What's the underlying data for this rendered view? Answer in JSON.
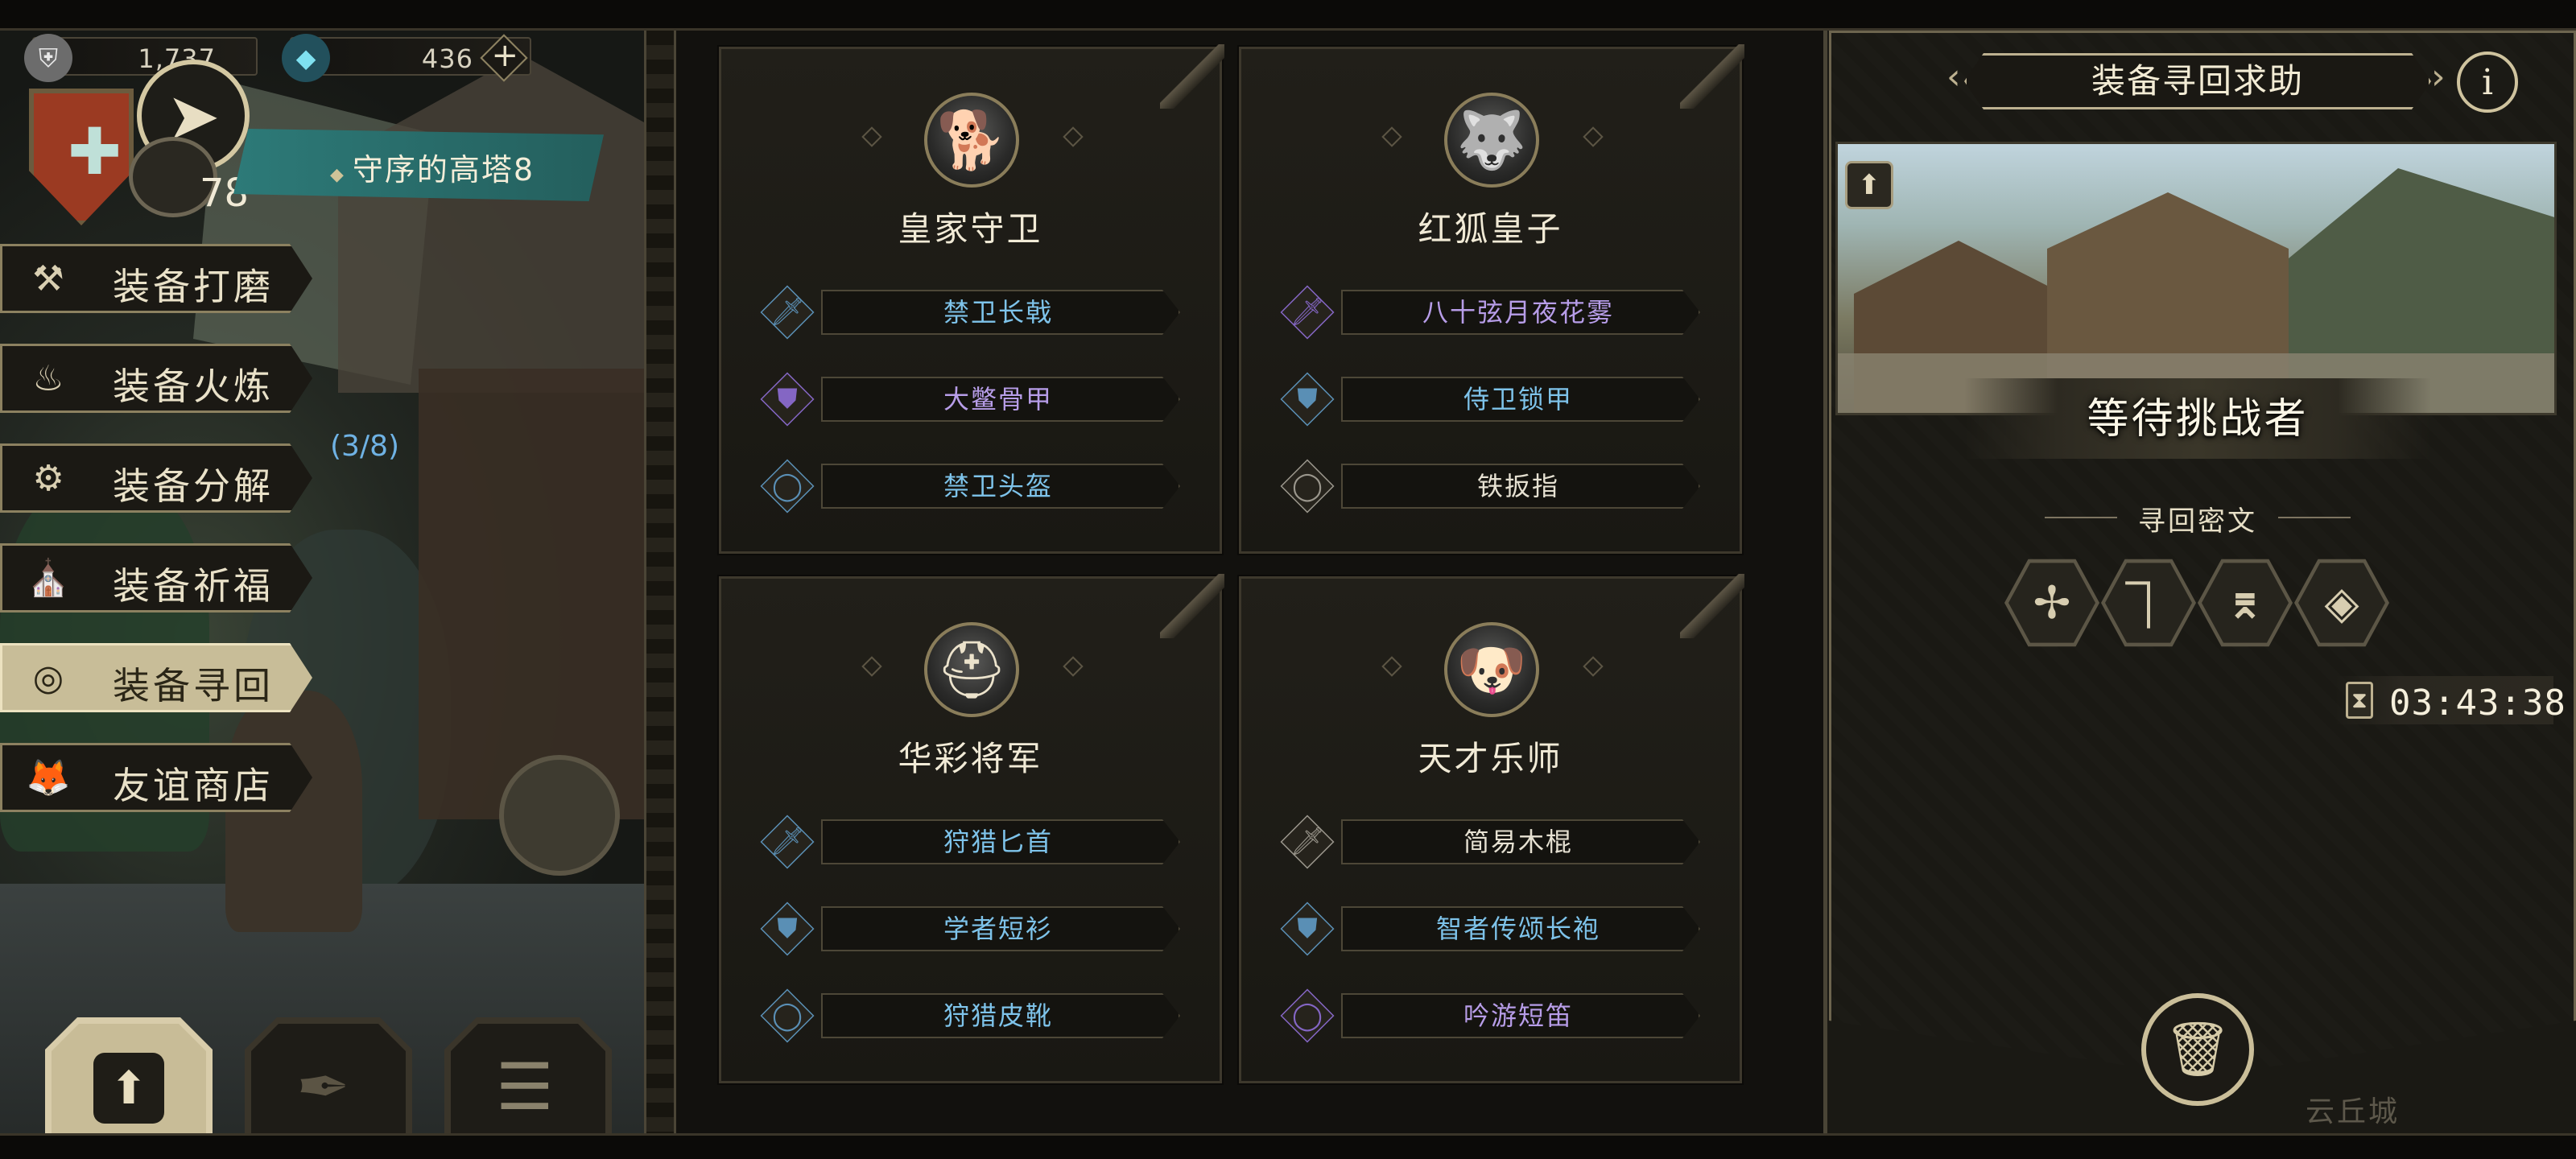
{
  "currencies": [
    {
      "name": "silver",
      "value": "1,737",
      "icon": "shield-coin-icon"
    },
    {
      "name": "gem",
      "value": "436",
      "icon": "crystal-icon"
    }
  ],
  "player": {
    "level": "78",
    "location": "守序的高塔8"
  },
  "left_menu": {
    "items": [
      {
        "key": "polish",
        "label": "装备打磨",
        "icon": "hammer-icon",
        "active": false
      },
      {
        "key": "forge",
        "label": "装备火炼",
        "icon": "flame-icon",
        "active": false
      },
      {
        "key": "dismantle",
        "label": "装备分解",
        "icon": "gear-break-icon",
        "active": false
      },
      {
        "key": "bless",
        "label": "装备祈福",
        "icon": "praying-hands-icon",
        "active": false
      },
      {
        "key": "retrieve",
        "label": "装备寻回",
        "icon": "target-icon",
        "active": true
      },
      {
        "key": "shop",
        "label": "友谊商店",
        "icon": "fox-icon",
        "active": false
      }
    ],
    "progress_text": "(3/8)"
  },
  "cards": [
    {
      "name": "皇家守卫",
      "portrait": "armored-dog-portrait",
      "equipment": [
        {
          "name": "禁卫长戟",
          "icon": "sword-icon",
          "color": "#7ec3ea",
          "slot_color": "#5a8fb5"
        },
        {
          "name": "大鳖骨甲",
          "icon": "armor-icon",
          "color": "#b79de8",
          "slot_color": "#8466c4"
        },
        {
          "name": "禁卫头盔",
          "icon": "ring-icon",
          "color": "#7ec3ea",
          "slot_color": "#5a8fb5"
        }
      ]
    },
    {
      "name": "红狐皇子",
      "portrait": "wolf-prince-portrait",
      "equipment": [
        {
          "name": "八十弦月夜花雾",
          "icon": "sword-icon",
          "color": "#b79de8",
          "slot_color": "#8466c4"
        },
        {
          "name": "侍卫锁甲",
          "icon": "armor-icon",
          "color": "#7ec3ea",
          "slot_color": "#5a8fb5"
        },
        {
          "name": "铁扳指",
          "icon": "ring-icon",
          "color": "#e6e1d2",
          "slot_color": "#9a968c"
        }
      ]
    },
    {
      "name": "华彩将军",
      "portrait": "helmeted-general-portrait",
      "equipment": [
        {
          "name": "狩猎匕首",
          "icon": "sword-icon",
          "color": "#7ec3ea",
          "slot_color": "#5a8fb5"
        },
        {
          "name": "学者短衫",
          "icon": "armor-icon",
          "color": "#7ec3ea",
          "slot_color": "#5a8fb5"
        },
        {
          "name": "狩猎皮靴",
          "icon": "ring-icon",
          "color": "#7ec3ea",
          "slot_color": "#5a8fb5"
        }
      ]
    },
    {
      "name": "天才乐师",
      "portrait": "dog-musician-portrait",
      "equipment": [
        {
          "name": "简易木棍",
          "icon": "sword-icon",
          "color": "#e6e1d2",
          "slot_color": "#9a968c"
        },
        {
          "name": "智者传颂长袍",
          "icon": "armor-icon",
          "color": "#7ec3ea",
          "slot_color": "#5a8fb5"
        },
        {
          "name": "吟游短笛",
          "icon": "ring-icon",
          "color": "#b79de8",
          "slot_color": "#8466c4"
        }
      ]
    }
  ],
  "right_panel": {
    "title": "装备寻回求助",
    "waiting_text": "等待挑战者",
    "cipher_label": "寻回密文",
    "runes": [
      "✢",
      "⏋",
      "⌆",
      "◈"
    ],
    "timer": "03:43:38",
    "background_text": "云丘城"
  },
  "bottom_buttons": [
    {
      "key": "upload",
      "icon": "upload-icon"
    },
    {
      "key": "quill",
      "icon": "quill-icon"
    },
    {
      "key": "list",
      "icon": "list-icon"
    }
  ]
}
